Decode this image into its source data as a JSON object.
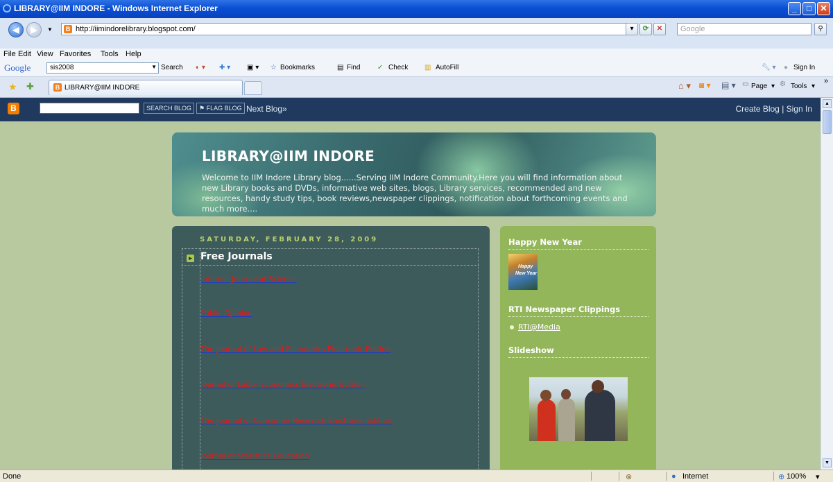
{
  "window": {
    "title": "LIBRARY@IIM INDORE - Windows Internet Explorer"
  },
  "address_bar": {
    "url": "http://iimindorelibrary.blogspot.com/",
    "search_placeholder": "Google"
  },
  "menu": [
    "File",
    "Edit",
    "View",
    "Favorites",
    "Tools",
    "Help"
  ],
  "google_toolbar": {
    "logo": "Google",
    "profile": "sis2008",
    "search": "Search",
    "bookmarks": "Bookmarks",
    "find": "Find",
    "check": "Check",
    "autofill": "AutoFill",
    "sign_in": "Sign In"
  },
  "tabs": [
    {
      "label": "LIBRARY@IIM INDORE"
    }
  ],
  "command_bar": {
    "page": "Page",
    "tools": "Tools"
  },
  "blogger_bar": {
    "search_blog": "SEARCH BLOG",
    "flag_blog": "FLAG BLOG",
    "next_blog": "Next Blog»",
    "create_signin": "Create Blog | Sign In"
  },
  "blog": {
    "title": "LIBRARY@IIM INDORE",
    "description": "Welcome to IIM Indore Library blog......Serving IIM Indore Community.Here you will find information about new Library books and DVDs, informative web sites, blogs, Library services, recommended and new resources, handy study tips, book reviews,newspaper clippings, notification about forthcoming events and much more....",
    "post_date": "SATURDAY, FEBRUARY 28, 2009",
    "post_title": "Free Journals",
    "links": [
      "Internet Journal of Science",
      "Public Opinion",
      "The Journal of Law and Economics Electronic Edition",
      "Journal of Labor Economics Electronic Edition",
      "The Journal of Consumer Research Electronic Edition",
      "Journal of Statistics Education"
    ]
  },
  "sidebar": {
    "happy_new_year": {
      "title": "Happy New Year",
      "image_text_1": "Happy",
      "image_text_2": "New Year"
    },
    "rti": {
      "title": "RTI Newspaper Clippings",
      "link": "RTI@Media"
    },
    "slideshow": {
      "title": "Slideshow"
    }
  },
  "status_bar": {
    "status": "Done",
    "zone": "Internet",
    "zoom": "100%"
  },
  "colors": {
    "title_bar": "#0a4fd4",
    "navbar": "#1f3a5e",
    "page_bg": "#b8c9a0",
    "post_bg": "#3e5b5b",
    "sidebar_bg": "#93b65a",
    "link": "#d42020",
    "date": "#b9d06f"
  },
  "icons": [
    "ie-icon",
    "back-icon",
    "forward-icon",
    "refresh-icon",
    "stop-icon",
    "search-icon",
    "favorites-star-icon",
    "add-favorites-icon",
    "blogger-icon",
    "home-icon",
    "feeds-icon",
    "print-icon",
    "internet-globe-icon",
    "zoom-icon"
  ]
}
